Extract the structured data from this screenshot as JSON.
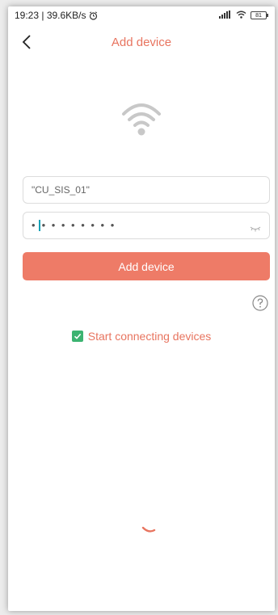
{
  "status_bar": {
    "time_speed": "19:23 | 39.6KB/s",
    "battery": "81"
  },
  "header": {
    "title": "Add device"
  },
  "form": {
    "ssid_value": "\"CU_SIS_01\"",
    "password_masked_left": "•",
    "password_masked_right": "• • • • • • • •",
    "submit_label": "Add device"
  },
  "status": {
    "message": "Start connecting devices"
  },
  "colors": {
    "accent": "#e8745f",
    "button": "#ee7b67",
    "check": "#3cb371"
  }
}
